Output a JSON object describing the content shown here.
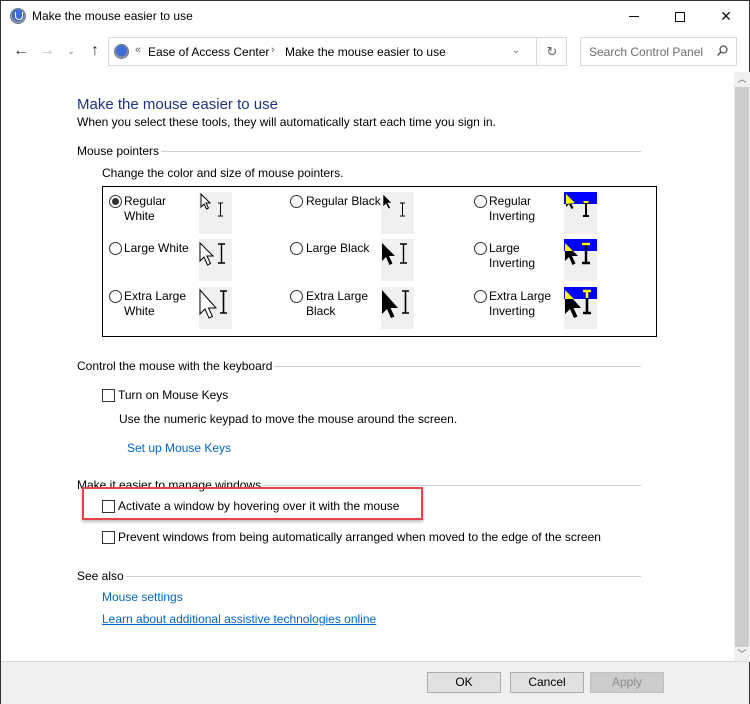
{
  "window": {
    "title": "Make the mouse easier to use",
    "controls": {
      "minimize": "minimize",
      "maximize": "maximize",
      "close": "close"
    }
  },
  "nav": {
    "breadcrumb_overflow": "«",
    "breadcrumb": [
      "Ease of Access Center",
      "Make the mouse easier to use"
    ],
    "breadcrumb_separator": "›",
    "search_placeholder": "Search Control Panel"
  },
  "page": {
    "title": "Make the mouse easier to use",
    "subtitle": "When you select these tools, they will automatically start each time you sign in."
  },
  "mouse_pointers": {
    "heading": "Mouse pointers",
    "description": "Change the color and size of mouse pointers.",
    "selected": "Regular White",
    "options": [
      {
        "line1": "Regular",
        "line2": "White",
        "style": "white",
        "size": "regular",
        "checked": true
      },
      {
        "line1": "Regular Black",
        "line2": "",
        "style": "black",
        "size": "regular",
        "checked": false
      },
      {
        "line1": "Regular",
        "line2": "Inverting",
        "style": "inverting",
        "size": "regular",
        "checked": false
      },
      {
        "line1": "Large White",
        "line2": "",
        "style": "white",
        "size": "large",
        "checked": false
      },
      {
        "line1": "Large Black",
        "line2": "",
        "style": "black",
        "size": "large",
        "checked": false
      },
      {
        "line1": "Large",
        "line2": "Inverting",
        "style": "inverting",
        "size": "large",
        "checked": false
      },
      {
        "line1": "Extra Large",
        "line2": "White",
        "style": "white",
        "size": "xlarge",
        "checked": false
      },
      {
        "line1": "Extra Large",
        "line2": "Black",
        "style": "black",
        "size": "xlarge",
        "checked": false
      },
      {
        "line1": "Extra Large",
        "line2": "Inverting",
        "style": "inverting",
        "size": "xlarge",
        "checked": false
      }
    ]
  },
  "keyboard": {
    "heading": "Control the mouse with the keyboard",
    "mouse_keys_label": "Turn on Mouse Keys",
    "mouse_keys_checked": false,
    "mouse_keys_description": "Use the numeric keypad to move the mouse around the screen.",
    "setup_link": "Set up Mouse Keys"
  },
  "windows": {
    "heading": "Make it easier to manage windows",
    "hover_activate_label": "Activate a window by hovering over it with the mouse",
    "hover_activate_checked": false,
    "prevent_arrange_label": "Prevent windows from being automatically arranged when moved to the edge of the screen",
    "prevent_arrange_checked": false
  },
  "see_also": {
    "heading": "See also",
    "links": [
      "Mouse settings",
      "Learn about additional assistive technologies online"
    ]
  },
  "footer": {
    "ok": "OK",
    "cancel": "Cancel",
    "apply": "Apply",
    "apply_enabled": false
  },
  "colors": {
    "title_blue": "#1e3287",
    "link_blue": "#0066cc",
    "highlight_red": "#e8434a",
    "inverting_band": "#0000ff",
    "inverting_yellow": "#ffff00"
  }
}
